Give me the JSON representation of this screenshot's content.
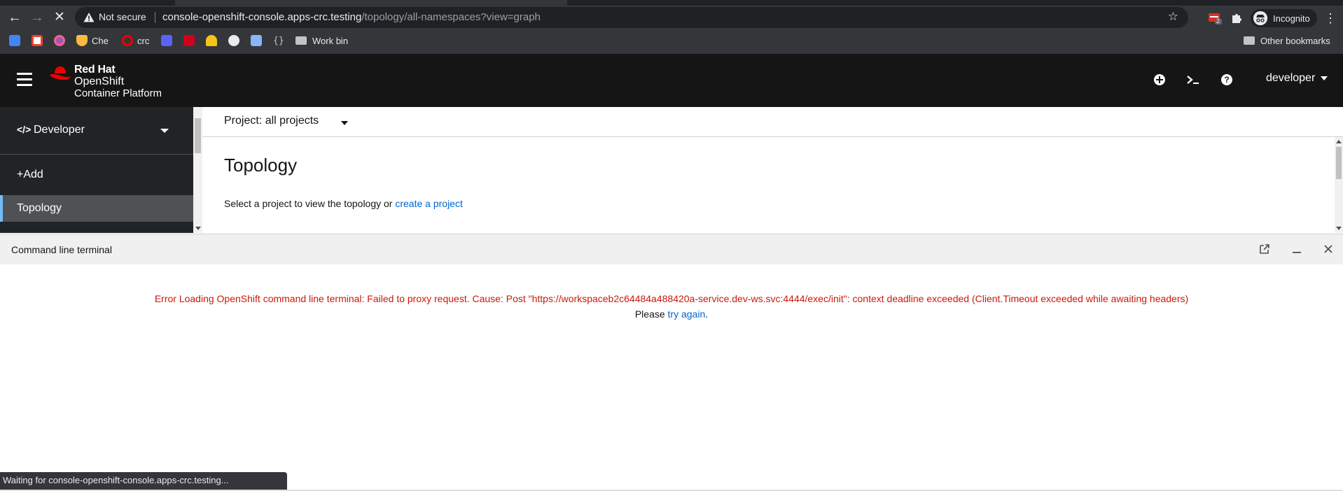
{
  "browser": {
    "security_label": "Not secure",
    "url_host": "console-openshift-console.apps-crc.testing",
    "url_path": "/topology/all-namespaces?view=graph",
    "extension_badge": "2",
    "profile_label": "Incognito",
    "status_text": "Waiting for console-openshift-console.apps-crc.testing...",
    "bookmarks": [
      {
        "label": "",
        "icon": "calendar-icon",
        "color": "#4285f4"
      },
      {
        "label": "",
        "icon": "gmail-icon",
        "color": "#ea4335"
      },
      {
        "label": "",
        "icon": "chrome-circle-icon",
        "color": "#9b59b6"
      },
      {
        "label": "Che",
        "icon": "che-icon",
        "color": "#fdb940"
      },
      {
        "label": "crc",
        "icon": "openshift-icon",
        "color": "#ee0000"
      },
      {
        "label": "",
        "icon": "discord-icon",
        "color": "#5865f2"
      },
      {
        "label": "",
        "icon": "d-icon",
        "color": "#d0021b"
      },
      {
        "label": "",
        "icon": "hardhat-icon",
        "color": "#f5c518"
      },
      {
        "label": "",
        "icon": "globe-icon",
        "color": "#e8eaed"
      },
      {
        "label": "",
        "icon": "y-icon",
        "color": "#8ab4f8"
      },
      {
        "label": "",
        "icon": "braces-icon",
        "color": "#bdc1c6"
      },
      {
        "label": "Work bin",
        "icon": "folder-icon",
        "color": "#c1c3c7"
      }
    ],
    "other_bookmarks": "Other bookmarks"
  },
  "masthead": {
    "brand_line1": "Red Hat",
    "brand_line2": "OpenShift",
    "brand_line3": "Container Platform",
    "user": "developer"
  },
  "sidebar": {
    "perspective": "Developer",
    "items": [
      {
        "label": "+Add"
      },
      {
        "label": "Topology"
      }
    ]
  },
  "main": {
    "project_selector": "Project: all projects",
    "title": "Topology",
    "message": "Select a project to view the topology or",
    "link": "create a project"
  },
  "terminal": {
    "title": "Command line terminal",
    "error": "Error Loading OpenShift command line terminal: Failed to proxy request. Cause: Post \"https://workspaceb2c64484a488420a-service.dev-ws.svc:4444/exec/init\": context deadline exceeded (Client.Timeout exceeded while awaiting headers)",
    "please": "Please",
    "retry": "try again",
    "period": "."
  },
  "colors": {
    "masthead": "#151515",
    "sidebar": "#212427",
    "sidebar_active": "#4f5255",
    "active_indicator": "#73bcf7",
    "link": "#0066cc",
    "error": "#c9190b",
    "redhat": "#ee0000"
  }
}
